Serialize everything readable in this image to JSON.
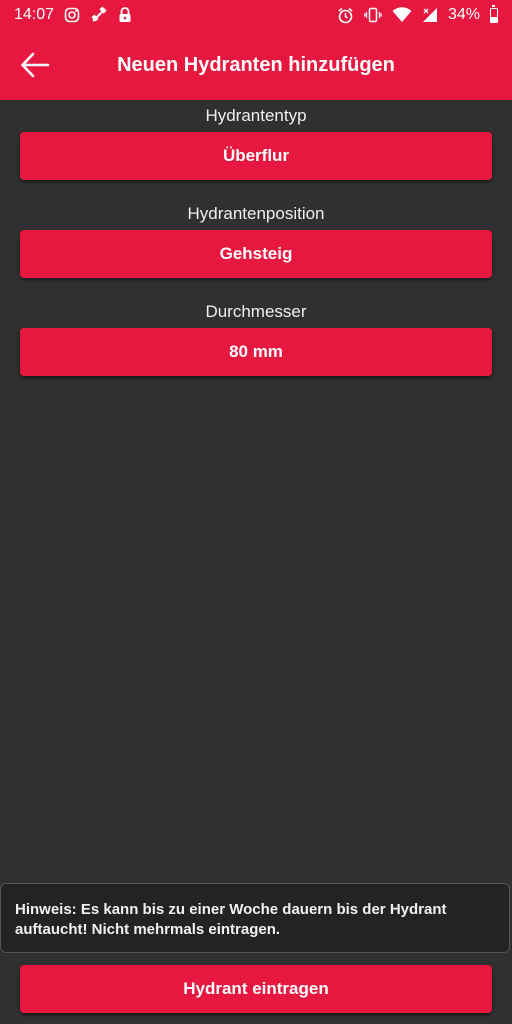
{
  "status_bar": {
    "time": "14:07",
    "battery": "34%",
    "icons_left": [
      "instagram-icon",
      "satellite-icon",
      "lock-icon"
    ],
    "icons_right": [
      "alarm-icon",
      "vibrate-icon",
      "wifi-icon",
      "signal-icon",
      "battery-icon"
    ]
  },
  "app_bar": {
    "title": "Neuen Hydranten hinzufügen",
    "back_icon": "back-arrow-icon"
  },
  "form": {
    "type_label": "Hydrantentyp",
    "type_value": "Überflur",
    "position_label": "Hydrantenposition",
    "position_value": "Gehsteig",
    "diameter_label": "Durchmesser",
    "diameter_value": "80 mm"
  },
  "hint": {
    "text": "Hinweis: Es kann bis zu einer Woche dauern bis der Hydrant auftaucht! Nicht mehrmals eintragen."
  },
  "submit": {
    "label": "Hydrant eintragen"
  },
  "colors": {
    "accent": "#e8173f",
    "background": "#303030"
  }
}
